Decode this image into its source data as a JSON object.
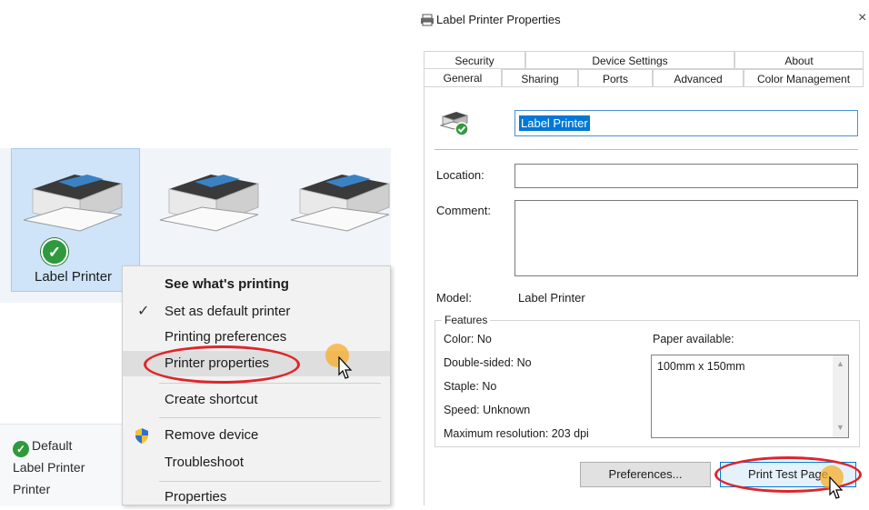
{
  "left": {
    "printers": [
      {
        "label": "Label Printer",
        "selected": true,
        "default": true
      },
      {
        "label": "",
        "selected": false,
        "default": false
      },
      {
        "label": "",
        "selected": false,
        "default": false
      }
    ],
    "details": {
      "status": "Default",
      "name_line1": "Label Printer",
      "name_line2": "Printer"
    }
  },
  "context_menu": {
    "items": [
      {
        "label": "See what's printing",
        "bold": true
      },
      {
        "label": "Set as default printer",
        "checked": true
      },
      {
        "label": "Printing preferences"
      },
      {
        "label": "Printer properties",
        "highlighted": true
      },
      {
        "label": "Create shortcut"
      },
      {
        "label": "Remove device",
        "icon": "shield-icon"
      },
      {
        "label": "Troubleshoot"
      },
      {
        "label": "Properties"
      }
    ]
  },
  "dialog": {
    "title": "Label Printer Properties",
    "close_glyph": "×",
    "tabs_row1": [
      "Security",
      "Device Settings",
      "About"
    ],
    "tabs_row2": [
      "General",
      "Sharing",
      "Ports",
      "Advanced",
      "Color Management"
    ],
    "active_tab": "General",
    "printer_name": "Label Printer",
    "location_label": "Location:",
    "location_value": "",
    "comment_label": "Comment:",
    "comment_value": "",
    "model_label": "Model:",
    "model_value": "Label Printer",
    "features": {
      "title": "Features",
      "color": "Color: No",
      "double_sided": "Double-sided: No",
      "staple": "Staple: No",
      "speed": "Speed: Unknown",
      "max_resolution": "Maximum resolution: 203 dpi",
      "paper_label": "Paper available:",
      "paper_items": [
        "100mm x 150mm"
      ]
    },
    "buttons": {
      "preferences": "Preferences...",
      "print_test_page": "Print Test Page"
    }
  },
  "colors": {
    "highlight_ring": "#e0242b",
    "click_marker": "#f7ac28",
    "selection_blue": "#0078d7",
    "default_check": "#2f9a3d"
  }
}
